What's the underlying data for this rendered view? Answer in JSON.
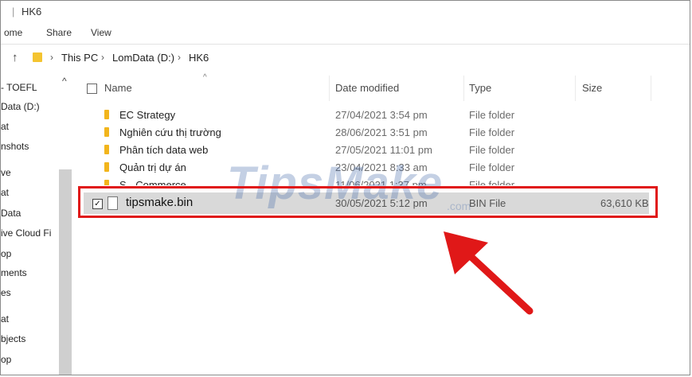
{
  "window": {
    "title": "HK6"
  },
  "ribbon": {
    "tabs": [
      "ome",
      "Share",
      "View"
    ]
  },
  "address": {
    "crumbs": [
      "This PC",
      "LomData (D:)",
      "HK6"
    ]
  },
  "nav": {
    "items": [
      "- TOEFL",
      "Data (D:)",
      "at",
      "nshots",
      "ve",
      "at",
      "Data",
      "ive Cloud Fi",
      "op",
      "ments",
      "es",
      "at",
      "bjects",
      "op"
    ]
  },
  "columns": {
    "name": "Name",
    "date": "Date modified",
    "type": "Type",
    "size": "Size"
  },
  "files": [
    {
      "name": "EC Strategy",
      "date": "27/04/2021 3:54 pm",
      "type": "File folder",
      "size": ""
    },
    {
      "name": "Nghiên cứu thị trường",
      "date": "28/06/2021 3:51 pm",
      "type": "File folder",
      "size": ""
    },
    {
      "name": "Phân tích data web",
      "date": "27/05/2021 11:01 pm",
      "type": "File folder",
      "size": ""
    },
    {
      "name": "Quản trị dự án",
      "date": "23/04/2021 8:33 am",
      "type": "File folder",
      "size": ""
    },
    {
      "name": "S - Commerce",
      "date": "11/06/2021 1:37 pm",
      "type": "File folder",
      "size": ""
    }
  ],
  "selected": {
    "name": "tipsmake.bin",
    "date": "30/05/2021 5:12 pm",
    "type": "BIN File",
    "size": "63,610 KB"
  },
  "watermark": {
    "brand": "TipsMake",
    "suffix": ".com"
  },
  "colors": {
    "highlight": "#e01818",
    "arrow": "#e01818",
    "folder": "#f2b51c"
  }
}
